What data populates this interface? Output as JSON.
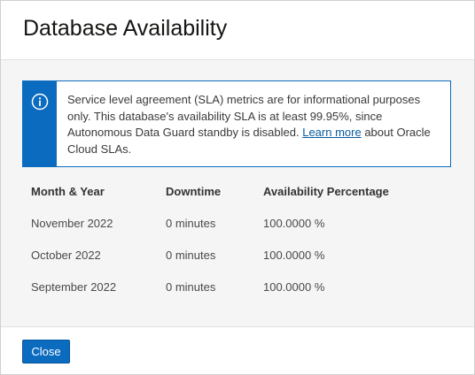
{
  "dialog": {
    "title": "Database Availability"
  },
  "info": {
    "icon": "info-circle-icon",
    "text_before": "Service level agreement (SLA) metrics are for informational purposes only. This database's availability SLA is at least 99.95%, since Autonomous Data Guard standby is disabled. ",
    "link_label": "Learn more",
    "text_after": " about Oracle Cloud SLAs.",
    "accent_color": "#0a6bbf"
  },
  "table": {
    "headers": [
      "Month & Year",
      "Downtime",
      "Availability Percentage"
    ],
    "rows": [
      [
        "November 2022",
        "0 minutes",
        "100.0000 %"
      ],
      [
        "October 2022",
        "0 minutes",
        "100.0000 %"
      ],
      [
        "September 2022",
        "0 minutes",
        "100.0000 %"
      ]
    ]
  },
  "footer": {
    "close_label": "Close"
  }
}
